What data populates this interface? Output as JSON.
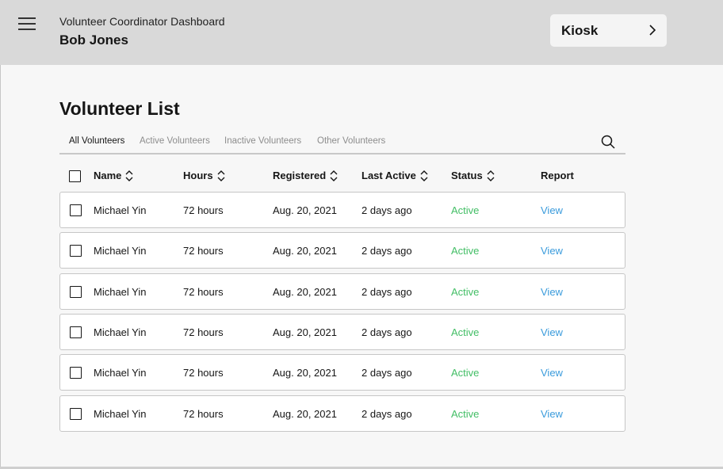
{
  "header": {
    "app_title": "Volunteer Coordinator Dashboard",
    "user_name": "Bob Jones",
    "kiosk_label": "Kiosk"
  },
  "list": {
    "title": "Volunteer List",
    "tabs": [
      {
        "label": "All Volunteers",
        "active": true
      },
      {
        "label": "Active Volunteers",
        "active": false
      },
      {
        "label": "Inactive Volunteers",
        "active": false
      },
      {
        "label": "Other Volunteers",
        "active": false
      }
    ],
    "columns": [
      "Name",
      "Hours",
      "Registered",
      "Last Active",
      "Status",
      "Report"
    ],
    "rows": [
      {
        "name": "Michael Yin",
        "hours": "72 hours",
        "registered": "Aug. 20, 2021",
        "last_active": "2 days ago",
        "status": "Active",
        "report": "View"
      },
      {
        "name": "Michael Yin",
        "hours": "72 hours",
        "registered": "Aug. 20, 2021",
        "last_active": "2 days ago",
        "status": "Active",
        "report": "View"
      },
      {
        "name": "Michael Yin",
        "hours": "72 hours",
        "registered": "Aug. 20, 2021",
        "last_active": "2 days ago",
        "status": "Active",
        "report": "View"
      },
      {
        "name": "Michael Yin",
        "hours": "72 hours",
        "registered": "Aug. 20, 2021",
        "last_active": "2 days ago",
        "status": "Active",
        "report": "View"
      },
      {
        "name": "Michael Yin",
        "hours": "72 hours",
        "registered": "Aug. 20, 2021",
        "last_active": "2 days ago",
        "status": "Active",
        "report": "View"
      },
      {
        "name": "Michael Yin",
        "hours": "72 hours",
        "registered": "Aug. 20, 2021",
        "last_active": "2 days ago",
        "status": "Active",
        "report": "View"
      }
    ]
  },
  "icons": {
    "menu": "hamburger-menu-icon",
    "kiosk": "chevron-right-icon",
    "search": "search-icon",
    "sort": "sort-icon",
    "checkbox": "checkbox-icon"
  },
  "colors": {
    "topbar": "#d9d9d9",
    "background": "#f7f7f7",
    "status_active": "#42be65",
    "link": "#3a9bdc"
  }
}
